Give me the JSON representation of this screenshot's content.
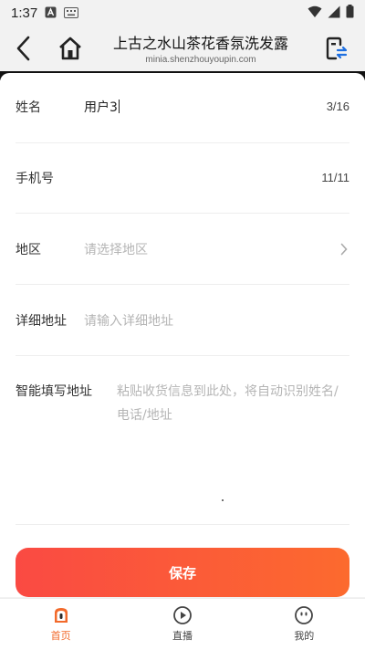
{
  "status_bar": {
    "time": "1:37"
  },
  "browser": {
    "title": "上古之水山茶花香氛洗发露",
    "url": "minia.shenzhouyoupin.com"
  },
  "form": {
    "name": {
      "label": "姓名",
      "value": "用户3",
      "count": "3/16"
    },
    "phone": {
      "label": "手机号",
      "value": "",
      "count": "11/11"
    },
    "region": {
      "label": "地区",
      "placeholder": "请选择地区"
    },
    "address": {
      "label": "详细地址",
      "placeholder": "请输入详细地址"
    },
    "smart": {
      "label": "智能填写地址",
      "placeholder": "粘贴收货信息到此处，将自动识别姓名/电话/地址"
    }
  },
  "save_label": "保存",
  "nav": [
    {
      "label": "首页",
      "icon": "home-icon",
      "active": true
    },
    {
      "label": "直播",
      "icon": "play-icon",
      "active": false
    },
    {
      "label": "我的",
      "icon": "profile-icon",
      "active": false
    }
  ],
  "colors": {
    "accent": "#f26a2b",
    "button_start": "#fa4a43",
    "button_end": "#fc6a2e"
  }
}
